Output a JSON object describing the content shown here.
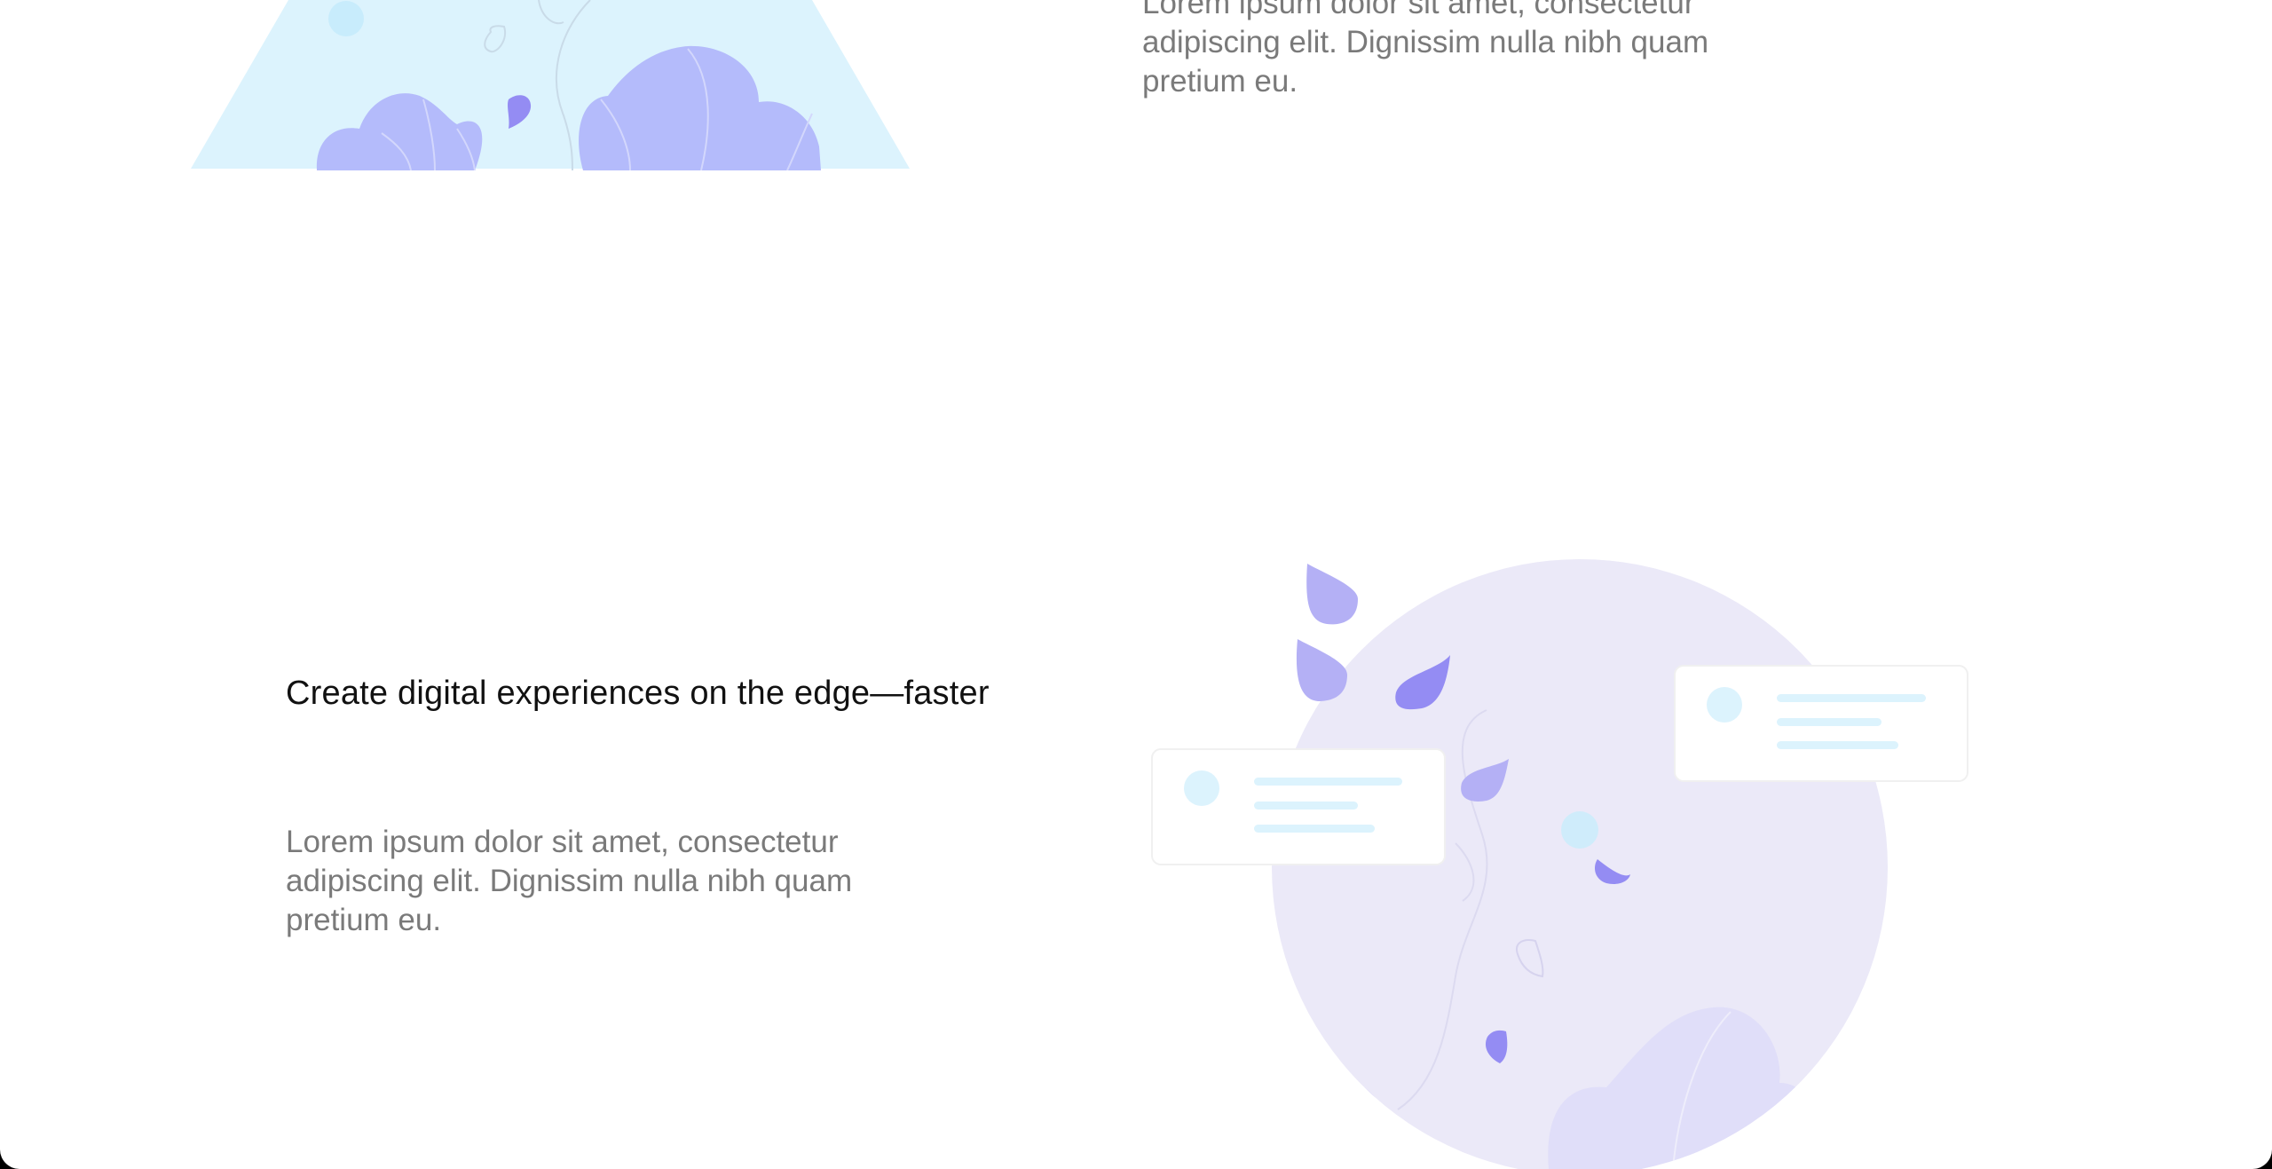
{
  "top_section": {
    "body_text": "Lorem ipsum dolor sit amet, consectetur adipiscing elit. Dignissim nulla nibh quam pretium eu."
  },
  "feature_section": {
    "title": "Create digital experiences on the edge—faster",
    "body_text": "Lorem ipsum dolor sit amet, consectetur adipiscing elit. Dignissim nulla nibh quam pretium eu."
  },
  "colors": {
    "background": "#ffffff",
    "heading": "#111111",
    "body_text": "#7a7a7a",
    "light_blue": "#dcf3fd",
    "lavender": "#b4bbfb",
    "purple": "#948cf3",
    "globe": "#ebe9f8"
  }
}
